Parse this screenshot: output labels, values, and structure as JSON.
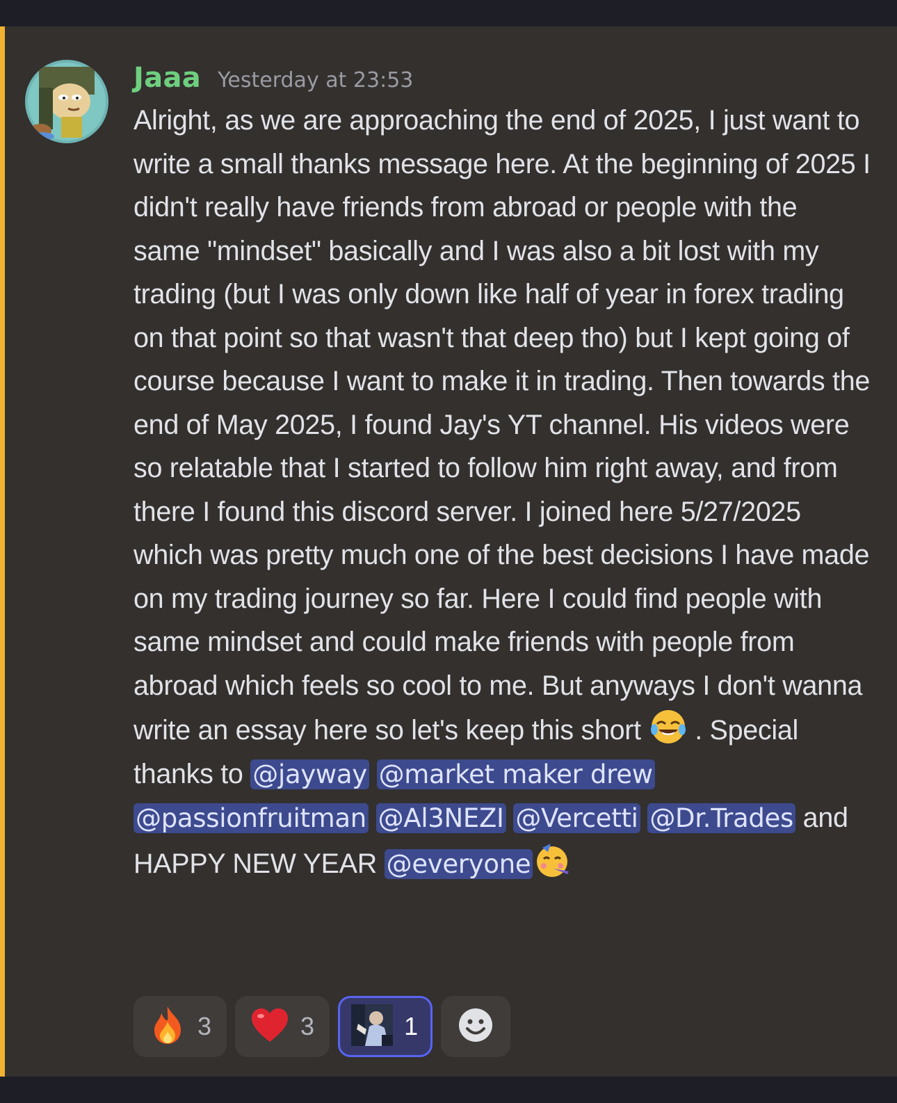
{
  "message": {
    "username": "Jaaa",
    "timestamp": "Yesterday at 23:53",
    "text_part1": "Alright, as we are approaching the end of 2025, I just want to write a small thanks message here. At the beginning of 2025 I didn't really have friends from abroad or people with the same \"mindset\" basically and I was also a bit lost with my trading (but I was only down like half of year in forex trading on that point so that wasn't that deep tho) but I kept going of course because I want to make it in trading. Then towards the end of May 2025, I found Jay's YT channel. His videos were so relatable that I started to follow him right away, and from there I found this discord server. I joined here 5/27/2025 which was pretty much one of the best decisions I have made on my trading journey so far. Here I could find people with same mindset and could make friends with people from abroad which feels so cool to me. But anyways I don't wanna write an essay here so let's keep this short ",
    "text_part2": " . Special thanks to ",
    "mentions": [
      "@jayway",
      "@market maker drew",
      "@passionfruitman",
      "@Al3NEZI",
      "@Vercetti",
      "@Dr.Trades"
    ],
    "text_part3": " and HAPPY NEW YEAR ",
    "mention_everyone": "@everyone",
    "inline_emoji_1": "joy-emoji",
    "inline_emoji_2": "partying-face-emoji"
  },
  "reactions": [
    {
      "emoji": "fire-emoji",
      "count": "3",
      "active": false
    },
    {
      "emoji": "heart-emoji",
      "count": "3",
      "active": false
    },
    {
      "emoji": "custom-sticker-emoji",
      "count": "1",
      "active": true
    }
  ],
  "colors": {
    "background": "#33302e",
    "username": "#6fcf7f",
    "mention_bg": "#3d4a8e",
    "highlight_bar": "#f0b232",
    "active_reaction_border": "#5865f2"
  }
}
